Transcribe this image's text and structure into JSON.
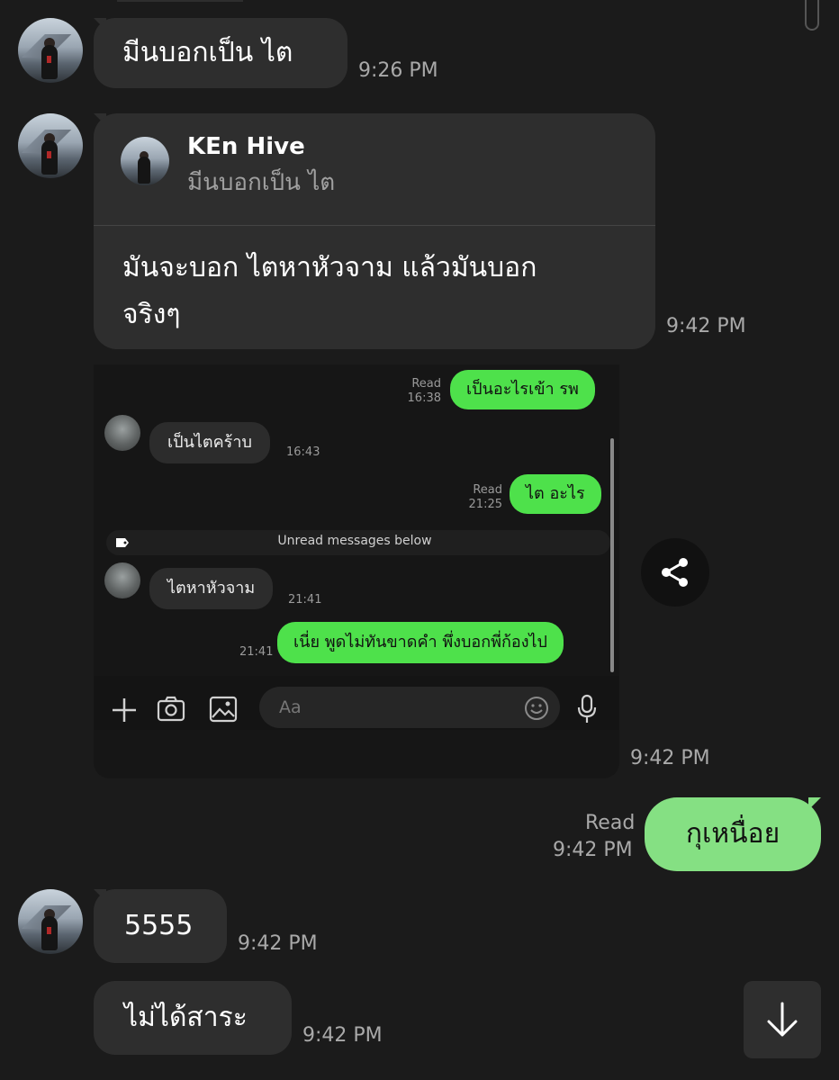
{
  "messages": {
    "m1": {
      "text": "มีนบอกเป็น ไต",
      "time": "9:26 PM"
    },
    "m2": {
      "reply_name": "KEn Hive",
      "reply_text": "มีนบอกเป็น ไต",
      "line1": "มันจะบอก ไตหาหัวจาม แล้วมันบอก",
      "line2": "จริงๆ",
      "time": "9:42 PM"
    },
    "shared_time": "9:42 PM",
    "m_out": {
      "read": "Read",
      "time": "9:42 PM",
      "text": "กุเหนื่อย"
    },
    "m4": {
      "text": "5555",
      "time": "9:42 PM"
    },
    "m5": {
      "text": "ไม่ได้สาระ",
      "time": "9:42 PM"
    }
  },
  "inner_chat": {
    "msg1": {
      "read": "Read",
      "time": "16:38",
      "text": "เป็นอะไรเข้า รพ"
    },
    "msg2": {
      "text": "เป็นไตคร้าบ",
      "time": "16:43"
    },
    "msg3": {
      "read": "Read",
      "time": "21:25",
      "text": "ไต อะไร"
    },
    "unread_label": "Unread messages below",
    "msg4": {
      "text": "ไตหาหัวจาม",
      "time": "21:41"
    },
    "msg5": {
      "time": "21:41",
      "text": "เนี่ย พูดไม่ทันขาดคำ พึ่งบอกพี่ก้องไป"
    },
    "input_placeholder": "Aa"
  },
  "icons": {
    "share": "share-icon",
    "scroll_down": "arrow-down-icon",
    "plus": "plus-icon",
    "camera": "camera-icon",
    "image": "image-icon",
    "emoji": "emoji-icon",
    "mic": "mic-icon"
  },
  "colors": {
    "background": "#1b1b1b",
    "incoming_bubble": "#2e2e2e",
    "outgoing_bubble": "#85e083",
    "inner_green": "#4ee14b",
    "meta_text": "#a9a9a9"
  }
}
